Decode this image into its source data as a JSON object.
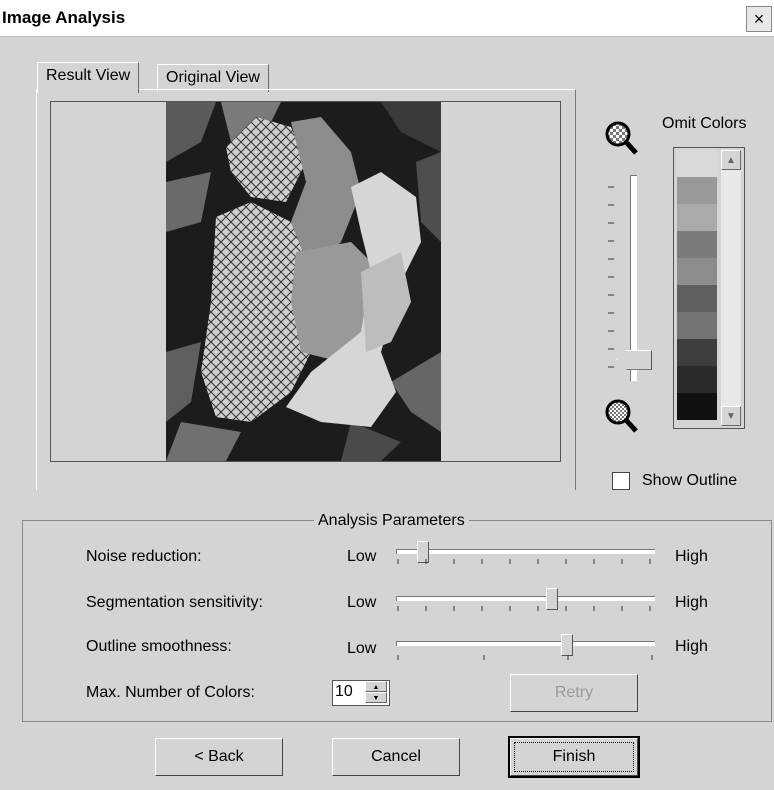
{
  "window": {
    "title": "Image Analysis",
    "close_glyph": "×"
  },
  "tabs": [
    {
      "label": "Result View",
      "active": true
    },
    {
      "label": "Original View",
      "active": false
    }
  ],
  "right_panel": {
    "omit_colors_label": "Omit Colors",
    "zoom_in_icon": "zoom-in-icon",
    "zoom_out_icon": "zoom-out-icon",
    "show_outline_label": "Show Outline",
    "show_outline_checked": false,
    "vertical_slider_level": 0.05,
    "swatch_colors": [
      "#d9d9d9",
      "#999999",
      "#aaaaaa",
      "#7b7b7b",
      "#8c8c8c",
      "#5f5f5f",
      "#737373",
      "#3e3e3e",
      "#2b2b2b",
      "#111111"
    ]
  },
  "analysis_parameters": {
    "title": "Analysis Parameters",
    "rows": [
      {
        "label": "Noise reduction:",
        "low": "Low",
        "high": "High",
        "value": 0.1
      },
      {
        "label": "Segmentation sensitivity:",
        "low": "Low",
        "high": "High",
        "value": 0.6
      },
      {
        "label": "Outline smoothness:",
        "low": "Low",
        "high": "High",
        "value": 0.66
      }
    ],
    "max_colors_label": "Max. Number of Colors:",
    "max_colors_value": "10",
    "retry_label": "Retry"
  },
  "footer": {
    "back_label": "< Back",
    "cancel_label": "Cancel",
    "finish_label": "Finish"
  }
}
